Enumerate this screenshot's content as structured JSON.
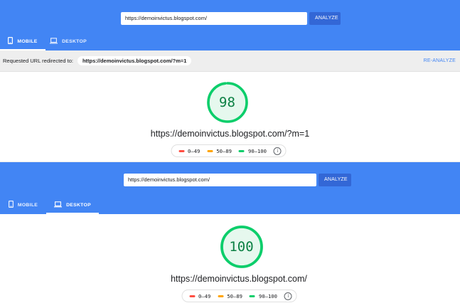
{
  "colors": {
    "header_blue": "#4285f4",
    "button_blue": "#3367d6",
    "pass_green": "#0cce6b",
    "pass_text_green": "#0b8043",
    "fail_red": "#ff4e42",
    "average_orange": "#ffa400"
  },
  "legend": {
    "fail": "0–49",
    "average": "50–89",
    "pass": "90–100",
    "info_icon": "info-icon"
  },
  "mobile_report": {
    "url_input": "https://demoinvictus.blogspot.com/",
    "analyze_label": "ANALYZE",
    "tabs": [
      {
        "label": "MOBILE",
        "icon": "smartphone-icon",
        "active": true
      },
      {
        "label": "DESKTOP",
        "icon": "laptop-icon",
        "active": false
      }
    ],
    "redirect_label": "Requested URL redirected to:",
    "redirect_url": "https://demoinvictus.blogspot.com/?m=1",
    "reanalyze_label": "RE-ANALYZE",
    "score": 98,
    "final_url": "https://demoinvictus.blogspot.com/?m=1"
  },
  "desktop_report": {
    "url_input": "https://demoinvictus.blogspot.com/",
    "analyze_label": "ANALYZE",
    "tabs": [
      {
        "label": "MOBILE",
        "icon": "smartphone-icon",
        "active": false
      },
      {
        "label": "DESKTOP",
        "icon": "laptop-icon",
        "active": true
      }
    ],
    "score": 100,
    "final_url": "https://demoinvictus.blogspot.com/"
  }
}
